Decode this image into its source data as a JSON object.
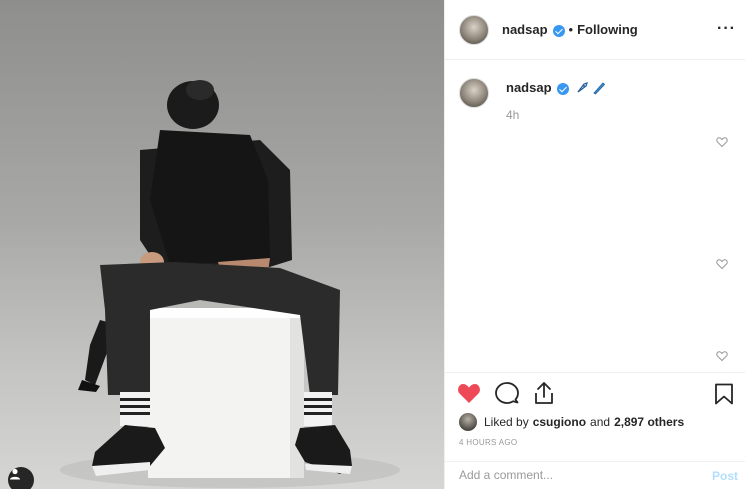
{
  "post": {
    "username": "nadsap",
    "follow_status": "Following",
    "separator": "•",
    "more_label": "···"
  },
  "caption": {
    "username": "nadsap",
    "time_ago": "4h"
  },
  "engagement": {
    "liked_prefix": "Liked by",
    "liked_user": "csugiono",
    "liked_and": "and",
    "liked_others": "2,897 others",
    "timestamp": "4 HOURS AGO"
  },
  "comment_box": {
    "placeholder": "Add a comment...",
    "post_label": "Post"
  },
  "colors": {
    "heart_liked": "#ed4956",
    "verified": "#3897f0",
    "post_disabled": "#b2dffc"
  },
  "icons": [
    "user-tag-icon",
    "verified-icon",
    "more-options-icon",
    "rocket-emoji",
    "surfboard-emoji",
    "heart-small-icon",
    "like-heart-icon",
    "comment-icon",
    "share-icon",
    "save-bookmark-icon"
  ]
}
